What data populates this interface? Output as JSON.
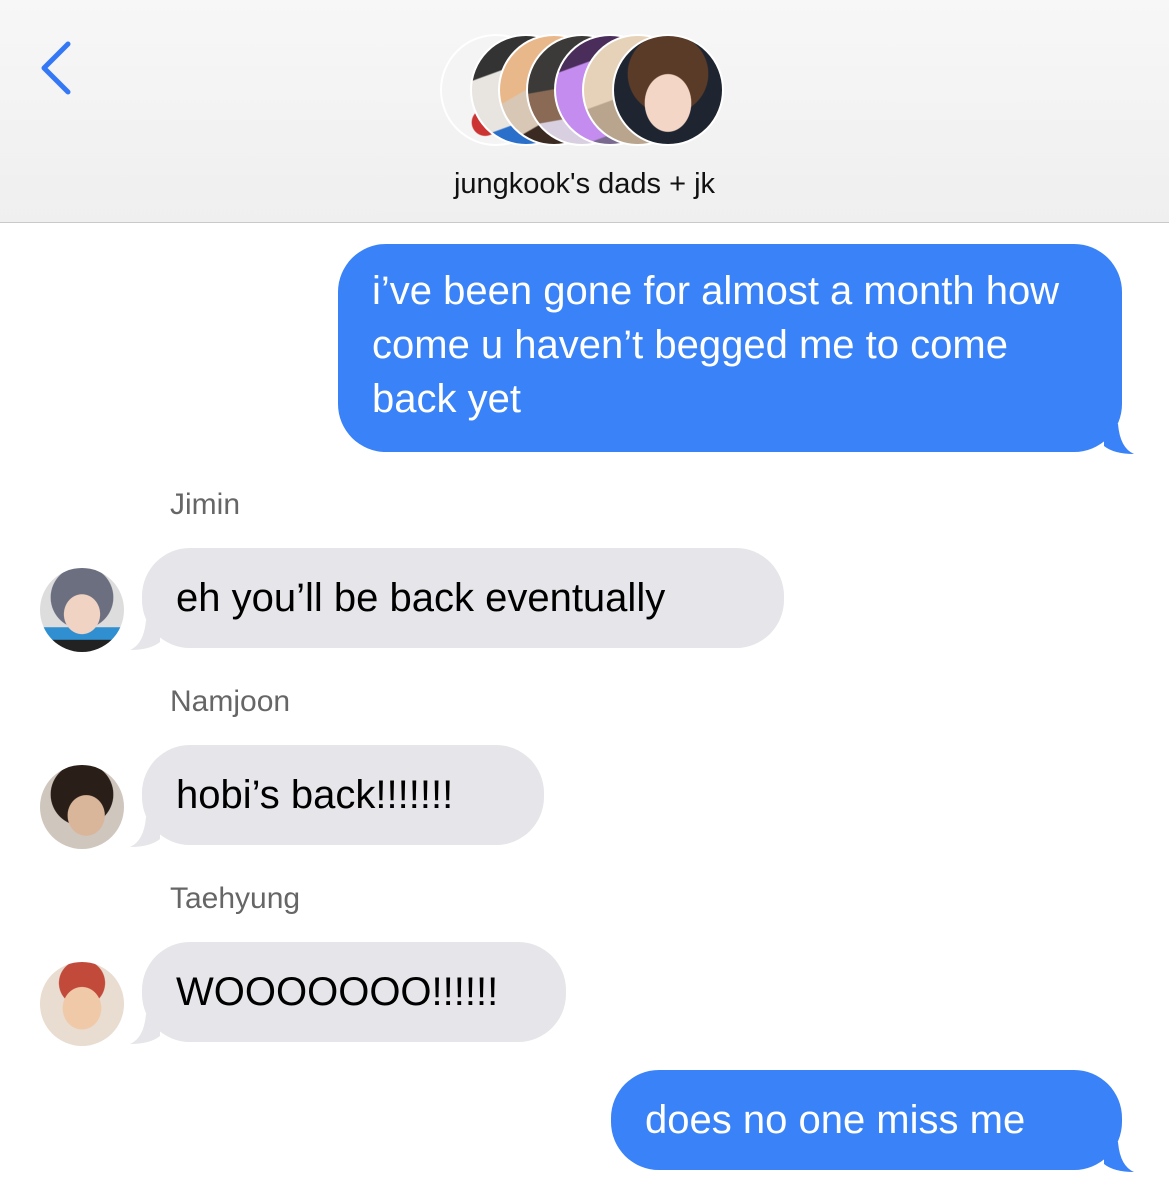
{
  "header": {
    "back_icon": "chevron-left-icon",
    "title": "jungkook's dads + jk",
    "accent_color": "#3478f6",
    "avatar_count": 7
  },
  "messages": [
    {
      "direction": "sent",
      "text": "i’ve been gone for almost a month how come u haven’t begged me to come back yet"
    },
    {
      "direction": "received",
      "sender": "Jimin",
      "text": "eh you’ll be back eventually"
    },
    {
      "direction": "received",
      "sender": "Namjoon",
      "text": "hobi’s back!!!!!!!"
    },
    {
      "direction": "received",
      "sender": "Taehyung",
      "text": "WOOOOOOO!!!!!!"
    },
    {
      "direction": "sent",
      "text": "does no one miss me"
    }
  ],
  "colors": {
    "sent_bubble": "#3a82f7",
    "received_bubble": "#e5e5ea"
  }
}
